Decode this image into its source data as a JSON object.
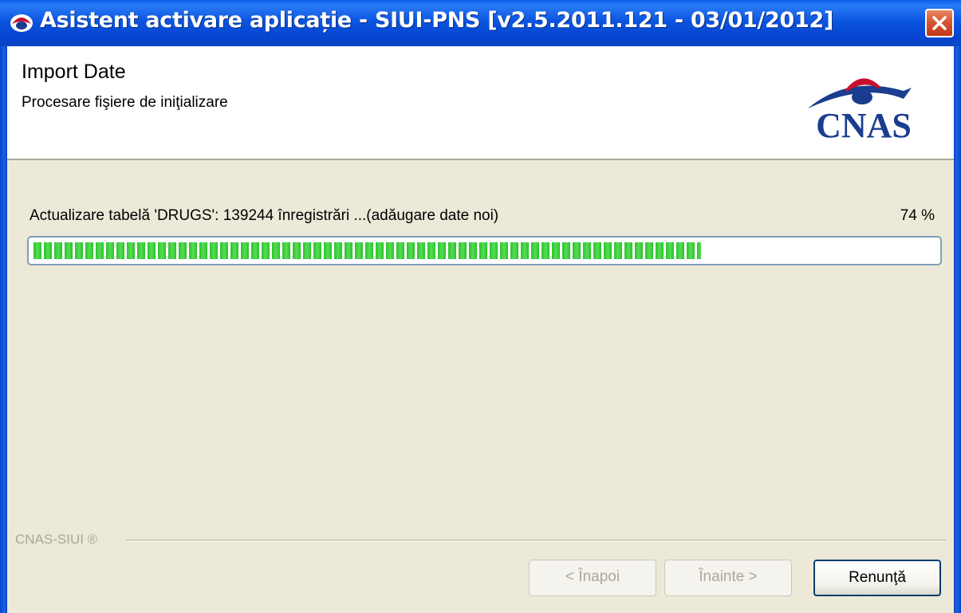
{
  "window": {
    "title": "Asistent activare aplicație - SIUI-PNS [v2.5.2011.121 - 03/01/2012]",
    "icon": "cnas-eye-icon",
    "close_icon": "close-icon"
  },
  "header": {
    "title": "Import Date",
    "subtitle": "Procesare fişiere de iniţializare",
    "logo_text": "CNAS"
  },
  "progress": {
    "status_text": "Actualizare tabelă 'DRUGS': 139244 înregistrări ...(adăugare date noi)",
    "percent_text": "74 %",
    "fraction": 0.74,
    "color": "#2cc12c"
  },
  "footer": {
    "brand": "CNAS-SIUI ®",
    "back_label": "< Înapoi",
    "next_label": "Înainte >",
    "cancel_label": "Renunţă"
  },
  "colors": {
    "titlebar": "#0645d0",
    "dialog_bg": "#ece9d8",
    "logo_blue": "#1a3d8f",
    "logo_red": "#c8102e"
  }
}
